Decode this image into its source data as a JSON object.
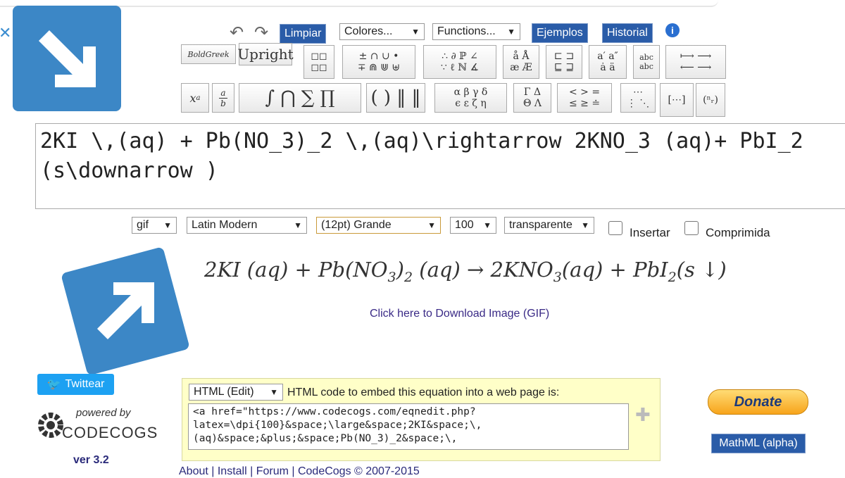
{
  "toolbar": {
    "undo_icon": "undo-icon",
    "redo_icon": "redo-icon",
    "clear_label": "Limpiar",
    "colors_label": "Colores...",
    "functions_label": "Functions...",
    "examples_label": "Ejemplos",
    "history_label": "Historial",
    "info_icon": "info-icon",
    "boldgreek_label": "BoldGreek",
    "upright_label": "Upright"
  },
  "editor": {
    "latex": "2KI \\,(aq) + Pb(NO_3)_2 \\,(aq)\\rightarrow 2KNO_3 (aq)+ PbI_2 (s\\downarrow )"
  },
  "options": {
    "format": "gif",
    "font": "Latin Modern",
    "size": "(12pt) Grande",
    "dpi": "100",
    "background": "transparente",
    "insert_label": "Insertar",
    "compressed_label": "Comprimida"
  },
  "preview": {
    "download_link": "Click here to Download Image (GIF)"
  },
  "embed": {
    "type": "HTML (Edit)",
    "description": "HTML code to embed this equation into a web page is:",
    "code": "<a href=\"https://www.codecogs.com/eqnedit.php?latex=\\dpi{100}&space;\\large&space;2KI&space;\\,(aq)&space;&plus;&space;Pb(NO_3)_2&space;\\,"
  },
  "sidebar": {
    "tweet_label": "Twittear",
    "powered_by": "powered by",
    "brand": "CODECOGS",
    "version": "ver 3.2"
  },
  "right": {
    "donate_label": "Donate",
    "mathml_label": "MathML (alpha)"
  },
  "footer": {
    "links": "About | Install | Forum | CodeCogs © 2007-2015"
  },
  "colors": {
    "accent_blue": "#2a5ca8",
    "arrow_box": "#3c87c6",
    "panel_yellow": "#ffffc8",
    "twitter": "#1da1f2"
  }
}
